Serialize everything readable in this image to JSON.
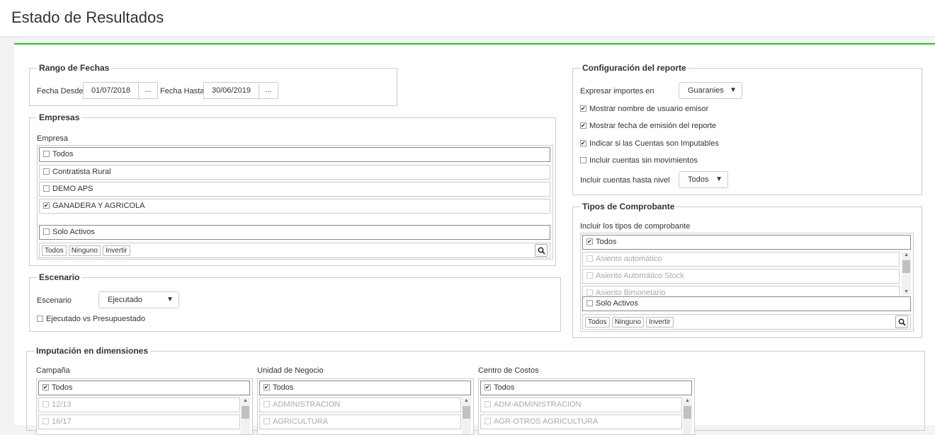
{
  "page": {
    "title": "Estado de Resultados"
  },
  "rango": {
    "legend": "Rango de Fechas",
    "desde_label": "Fecha Desde",
    "desde_value": "01/07/2018",
    "hasta_label": "Fecha Hasta",
    "hasta_value": "30/06/2019",
    "picker_label": "..."
  },
  "empresas": {
    "legend": "Empresas",
    "label": "Empresa",
    "todos": "Todos",
    "items": [
      "Contratista Rural",
      "DEMO APS",
      "GANADERA Y AGRICOLA"
    ],
    "checked": [
      false,
      false,
      true
    ],
    "solo_activos": "Solo Activos",
    "buttons": {
      "todos": "Todos",
      "ninguno": "Ninguno",
      "invertir": "Invertir"
    }
  },
  "escenario": {
    "legend": "Escenario",
    "label": "Escenario",
    "value": "Ejecutado",
    "vs_label": "Ejecutado vs Presupuestado"
  },
  "config": {
    "legend": "Configuración del reporte",
    "expresar_label": "Expresar importes en",
    "expresar_value": "Guaranies",
    "opt1": "Mostrar nombre de usuario emisor",
    "opt2": "Mostrar fecha de emisión del reporte",
    "opt3": "Indicar si las Cuentas son Imputables",
    "opt4": "Incluir cuentas sin movimientos",
    "nivel_label": "Incluir cuentas hasta nivel",
    "nivel_value": "Todos"
  },
  "tipos": {
    "legend": "Tipos de Comprobante",
    "label": "Incluir los tipos de comprobante",
    "todos": "Todos",
    "items": [
      "Asiento automático",
      "Asiento Automático Stock",
      "Asiento Bimonetario"
    ],
    "solo_activos": "Solo Activos",
    "buttons": {
      "todos": "Todos",
      "ninguno": "Ninguno",
      "invertir": "Invertir"
    }
  },
  "imputacion": {
    "legend": "Imputación en dimensiones",
    "campana": {
      "label": "Campaña",
      "todos": "Todos",
      "items": [
        "12/13",
        "16/17"
      ]
    },
    "unidad": {
      "label": "Unidad de Negocio",
      "todos": "Todos",
      "items": [
        "ADMINISTRACION",
        "AGRICULTURA"
      ]
    },
    "centro": {
      "label": "Centro de Costos",
      "todos": "Todos",
      "items": [
        "ADM-ADMINISTRACION",
        "AGR-OTROS AGRICULTURA"
      ]
    }
  },
  "colors": {
    "accent": "#29c229",
    "border": "#cccccc"
  }
}
